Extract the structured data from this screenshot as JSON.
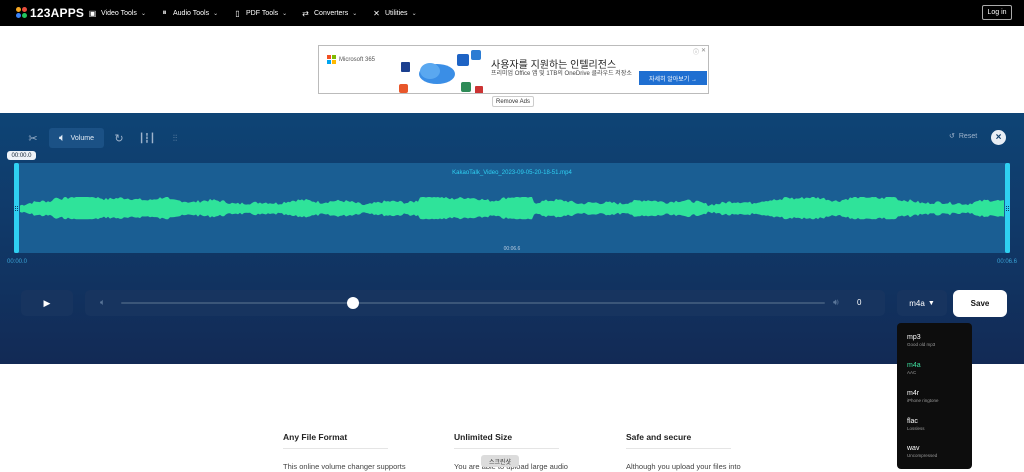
{
  "nav": {
    "logo": "123APPS",
    "items": [
      {
        "label": "Video Tools",
        "icon": "video-icon"
      },
      {
        "label": "Audio Tools",
        "icon": "audio-icon"
      },
      {
        "label": "PDF Tools",
        "icon": "pdf-icon"
      },
      {
        "label": "Converters",
        "icon": "converters-icon"
      },
      {
        "label": "Utilities",
        "icon": "utilities-icon"
      }
    ],
    "login": "Log in"
  },
  "ad": {
    "brand": "Microsoft 365",
    "title": "사용자를 지원하는 인텔리전스",
    "subtitle": "프리미엄 Office 앱 및 1TB의 OneDrive 클라우드 저장소",
    "cta": "자세히 알아보기 →",
    "remove": "Remove Ads"
  },
  "editor": {
    "tools": [
      {
        "name": "cut",
        "icon": "scissors-icon"
      },
      {
        "name": "volume",
        "icon": "volume-icon",
        "label": "Volume",
        "active": true
      },
      {
        "name": "speed",
        "icon": "speed-icon"
      },
      {
        "name": "equalizer",
        "icon": "equalizer-icon"
      },
      {
        "name": "settings",
        "icon": "sliders-icon"
      }
    ],
    "reset": "Reset",
    "file_name": "KakaoTalk_Video_2023-09-05-20-18-51.mp4",
    "time_bubble": "00:00.0",
    "mid_time": "00:06.6",
    "start_time": "00:00.0",
    "end_time": "00:06.6",
    "volume_value": "0",
    "volume_level": 0.33,
    "format": "m4a",
    "save": "Save",
    "wave_color": "#2fe39a",
    "handle_color": "#2fd0f2"
  },
  "formats": [
    {
      "name": "mp3",
      "desc": "Good old mp3",
      "selected": false
    },
    {
      "name": "m4a",
      "desc": "AAC",
      "selected": true
    },
    {
      "name": "m4r",
      "desc": "iPhone ringtone",
      "selected": false
    },
    {
      "name": "flac",
      "desc": "Lossless",
      "selected": false
    },
    {
      "name": "wav",
      "desc": "Uncompressed",
      "selected": false
    }
  ],
  "features": [
    {
      "title": "Any File Format",
      "text": "This online volume changer supports all popular file formats"
    },
    {
      "title": "Unlimited Size",
      "text": "You are able to upload large audio and video files. This app"
    },
    {
      "title": "Safe and secure",
      "text": "Although you upload your files into our online audio tools, no"
    }
  ],
  "tooltip": "스크린샷"
}
